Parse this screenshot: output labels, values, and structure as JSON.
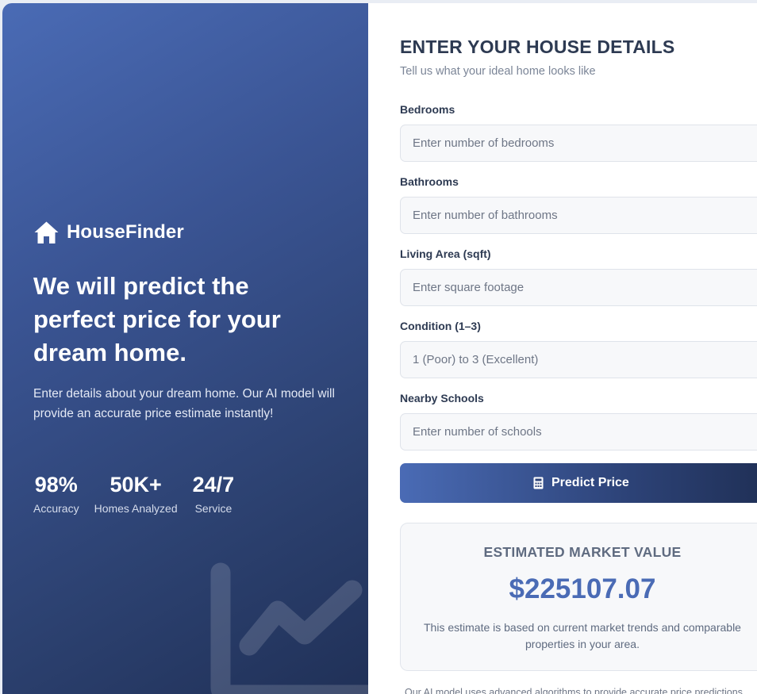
{
  "hero": {
    "brand": "HouseFinder",
    "brand_icon": "house-icon",
    "headline": "We will predict the perfect price for your dream home.",
    "intro": "Enter details about your dream home. Our AI model will provide an accurate price estimate instantly!",
    "stats": [
      {
        "value": "98%",
        "label": "Accuracy"
      },
      {
        "value": "50K+",
        "label": "Homes Analyzed"
      },
      {
        "value": "24/7",
        "label": "Service"
      }
    ],
    "decoration_icon": "chart-line-icon"
  },
  "form": {
    "title": "ENTER YOUR HOUSE DETAILS",
    "subtitle": "Tell us what your ideal home looks like",
    "fields": [
      {
        "label": "Bedrooms",
        "placeholder": "Enter number of bedrooms",
        "value": ""
      },
      {
        "label": "Bathrooms",
        "placeholder": "Enter number of bathrooms",
        "value": ""
      },
      {
        "label": "Living Area (sqft)",
        "placeholder": "Enter square footage",
        "value": ""
      },
      {
        "label": "Condition (1–3)",
        "placeholder": "1 (Poor) to 3 (Excellent)",
        "value": ""
      },
      {
        "label": "Nearby Schools",
        "placeholder": "Enter number of schools",
        "value": ""
      }
    ],
    "submit_label": "Predict Price",
    "submit_icon": "calculator-icon"
  },
  "result": {
    "title": "ESTIMATED MARKET VALUE",
    "value": "$225107.07",
    "note": "This estimate is based on current market trends and comparable properties in your area."
  },
  "footnote": "Our AI model uses advanced algorithms to provide accurate price predictions",
  "colors": {
    "accent": "#4a6bb5",
    "hero_dark": "#1f2f55",
    "text_dark": "#2d3a52",
    "text_muted": "#5f6b80"
  }
}
